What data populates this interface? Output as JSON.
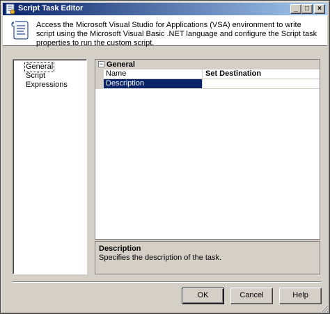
{
  "window": {
    "title": "Script Task Editor",
    "minimize_glyph": "_",
    "maximize_glyph": "□",
    "close_glyph": "×"
  },
  "header": {
    "description": "Access the Microsoft Visual Studio for Applications (VSA) environment to write script using the Microsoft Visual Basic .NET language and configure the Script task properties to run the custom script.",
    "icon": "script-task-icon"
  },
  "nav": {
    "items": [
      {
        "label": "General",
        "selected": true
      },
      {
        "label": "Script",
        "selected": false
      },
      {
        "label": "Expressions",
        "selected": false
      }
    ]
  },
  "grid": {
    "category": "General",
    "toggle_glyph": "−",
    "rows": [
      {
        "name": "Name",
        "value": "Set Destination",
        "selected": false
      },
      {
        "name": "Description",
        "value": "",
        "selected": true
      }
    ]
  },
  "description_pane": {
    "title": "Description",
    "text": "Specifies the description of the task."
  },
  "buttons": {
    "ok": "OK",
    "cancel": "Cancel",
    "help": "Help"
  },
  "colors": {
    "titlebar_start": "#0a246a",
    "titlebar_end": "#a6caf0",
    "selection": "#0a246a",
    "face": "#d4d0c8"
  }
}
